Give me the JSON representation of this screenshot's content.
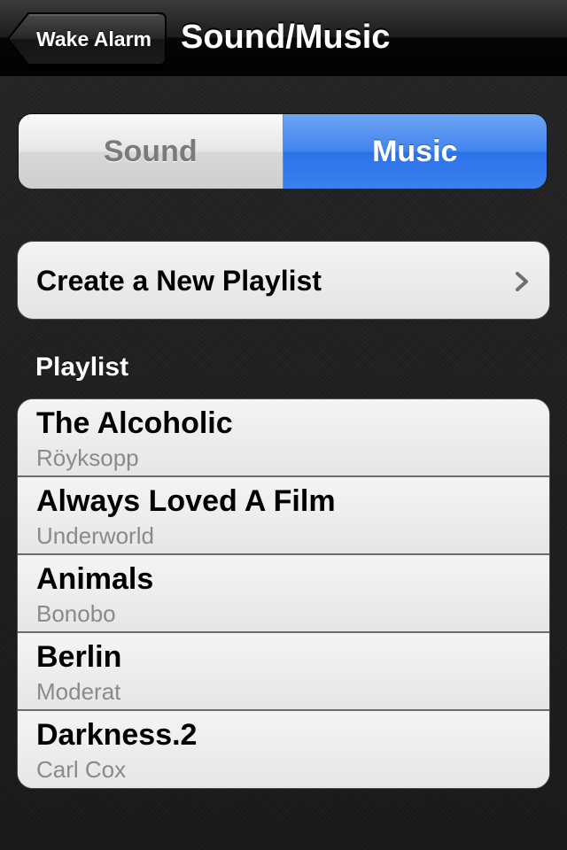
{
  "navbar": {
    "back_label": "Wake Alarm",
    "title": "Sound/Music"
  },
  "segmented": {
    "options": [
      "Sound",
      "Music"
    ],
    "selected": "Music",
    "accent_color": "#3b80f0"
  },
  "create_playlist": {
    "label": "Create a New Playlist",
    "icon": "chevron-right-icon"
  },
  "playlist_section": {
    "header": "Playlist",
    "items": [
      {
        "title": "The Alcoholic",
        "artist": "Röyksopp"
      },
      {
        "title": "Always Loved A Film",
        "artist": "Underworld"
      },
      {
        "title": "Animals",
        "artist": "Bonobo"
      },
      {
        "title": "Berlin",
        "artist": "Moderat"
      },
      {
        "title": "Darkness.2",
        "artist": "Carl Cox"
      }
    ]
  }
}
